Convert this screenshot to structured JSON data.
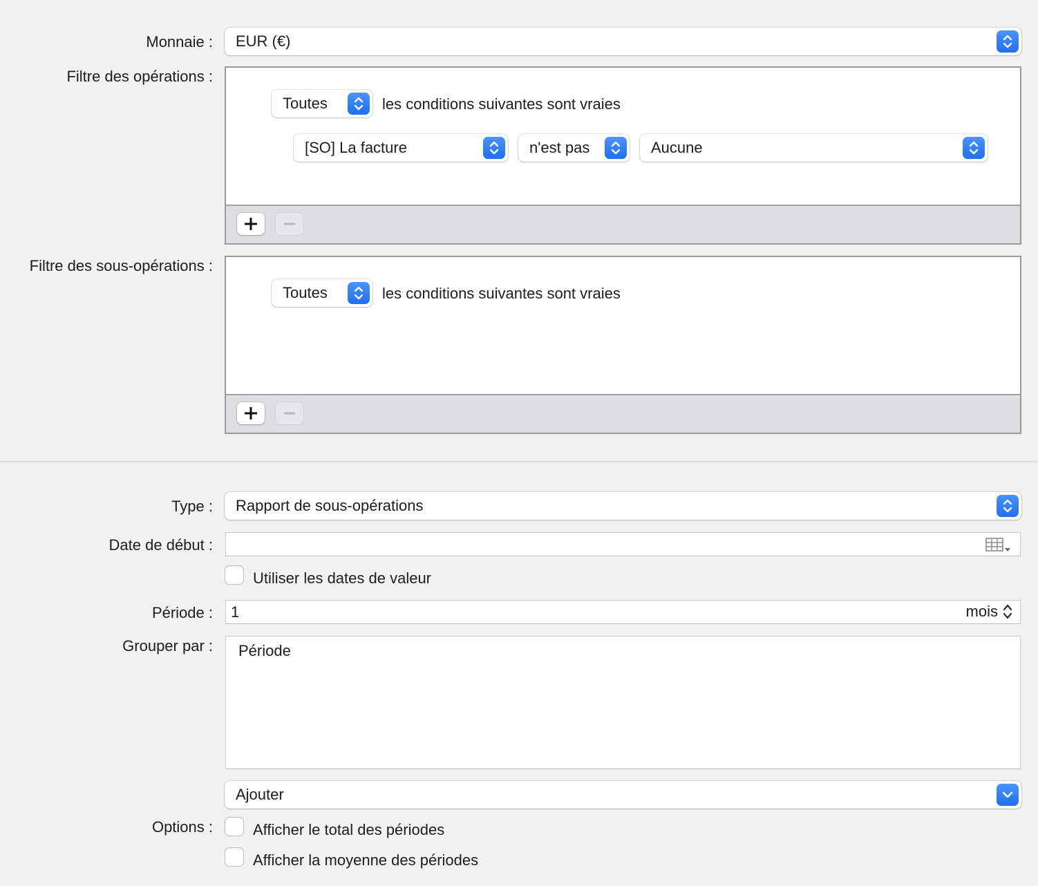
{
  "currency": {
    "label": "Monnaie :",
    "value": "EUR (€)"
  },
  "operations_filter": {
    "label": "Filtre des opérations :",
    "match_mode": "Toutes",
    "match_text": "les conditions suivantes sont vraies",
    "rule": {
      "field": "[SO] La facture",
      "operator": "n'est pas",
      "value": "Aucune"
    }
  },
  "suboperations_filter": {
    "label": "Filtre des sous-opérations :",
    "match_mode": "Toutes",
    "match_text": "les conditions suivantes sont vraies"
  },
  "report_type": {
    "label": "Type :",
    "value": "Rapport de sous-opérations"
  },
  "start_date": {
    "label": "Date de début :",
    "value": ""
  },
  "use_value_dates": {
    "label": "Utiliser les dates de valeur",
    "checked": false
  },
  "period": {
    "label": "Période :",
    "value": "1",
    "unit": "mois"
  },
  "group_by": {
    "label": "Grouper par :",
    "items": [
      "Période"
    ],
    "add_label": "Ajouter"
  },
  "options": {
    "label": "Options :",
    "show_total": "Afficher le total des périodes",
    "show_average": "Afficher la moyenne des périodes"
  },
  "colors": {
    "accent": "#2a7ef5",
    "background": "#f1f1f1",
    "footer": "#dcdee2"
  }
}
